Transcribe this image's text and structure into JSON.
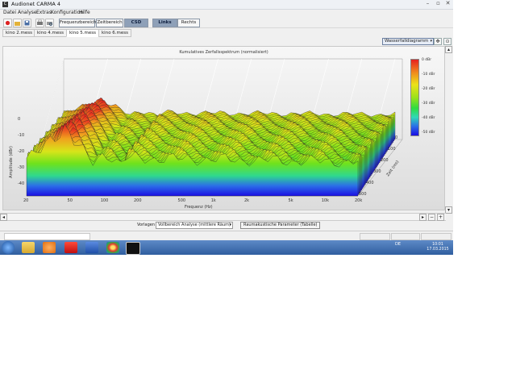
{
  "window": {
    "title": "Audionet CARMA 4",
    "app_icon_letter": "C",
    "min": "–",
    "max": "▫",
    "close": "✕"
  },
  "menu": [
    "Datei",
    "Analyse",
    "Extras",
    "Konfiguration",
    "Hilfe"
  ],
  "toolbar": {
    "icons": [
      "record-icon",
      "open-folder-icon",
      "save-icon",
      "print-icon",
      "print-preview-icon"
    ],
    "buttons": [
      {
        "label": "Frequenzbereich",
        "active": false
      },
      {
        "label": "Zeitbereich",
        "active": false
      },
      {
        "label": "CSD",
        "active": true
      },
      {
        "label": "Links",
        "active": true
      },
      {
        "label": "Rechts",
        "active": false
      }
    ]
  },
  "tabs": [
    {
      "label": "kino 2.mess",
      "active": false
    },
    {
      "label": "kino 4.mess",
      "active": false
    },
    {
      "label": "kino 5.mess",
      "active": true,
      "close": "×"
    },
    {
      "label": "kino 6.mess",
      "active": false
    }
  ],
  "view": {
    "select": "Wasserfalldiagramm",
    "arrow": "▾",
    "btn1": "✥",
    "btn2": "⊙"
  },
  "chart_data": {
    "type": "area",
    "title": "Kumulatives Zerfallsspektrum (normalisiert)",
    "xlabel": "Frequenz (Hz)",
    "ylabel": "Amplitude (dBr)",
    "zlabel": "Zeit (ms)",
    "x_ticks": [
      "20",
      "50",
      "100",
      "200",
      "500",
      "1k",
      "2k",
      "5k",
      "10k",
      "20k"
    ],
    "y_ticks": [
      "0",
      "-10",
      "-20",
      "-30",
      "-40"
    ],
    "z_ticks": [
      "0",
      "100",
      "200",
      "300",
      "400",
      "500"
    ],
    "colorbar_ticks": [
      "0 dBr",
      "-10 dBr",
      "-20 dBr",
      "-30 dBr",
      "-40 dBr",
      "-50 dBr"
    ],
    "colorbar_colors": [
      "#e62020",
      "#f08a1e",
      "#ece219",
      "#9be21a",
      "#2fdc40",
      "#2fd9b7",
      "#2b6ee8",
      "#1b0ee3"
    ],
    "x_log": true
  },
  "scroll": {
    "left": "◂",
    "right": "▸",
    "up": "▴",
    "down": "▾",
    "plus": "+",
    "minus": "−"
  },
  "bottom": {
    "vorlagen_label": "Vorlagen",
    "vorlagen_value": "Vollbereich Analyse (mittlere Räum)",
    "combo_arrow": "▾",
    "button": "Raumakustische Parameter (Tabelle)"
  },
  "taskbar": {
    "lang": "DE",
    "time": "10:01",
    "date": "17.03.2015"
  }
}
